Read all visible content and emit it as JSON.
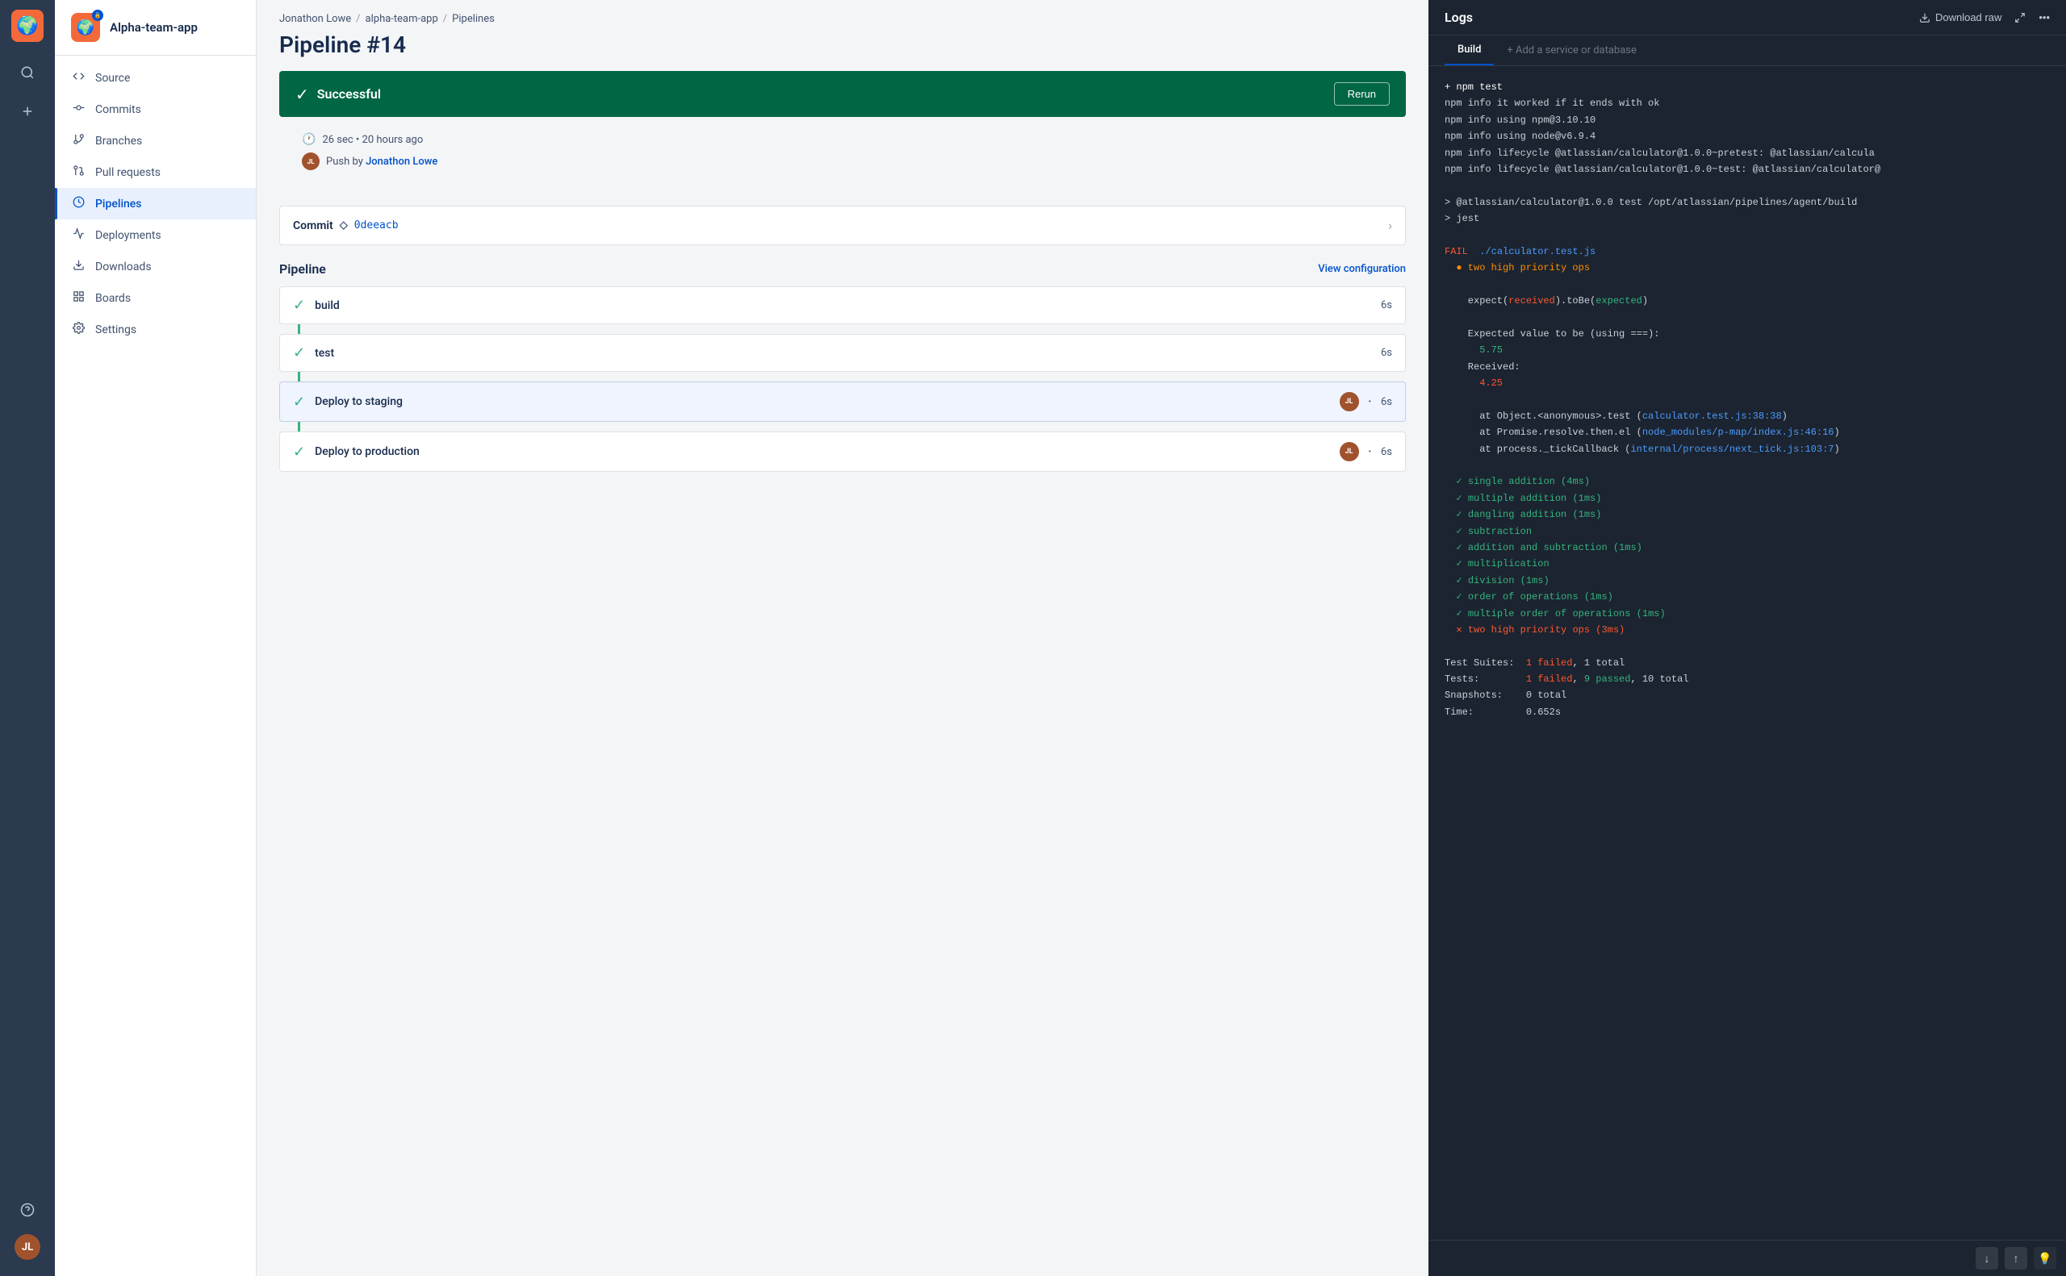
{
  "app": {
    "name": "Alpha-team-app"
  },
  "iconBar": {
    "searchLabel": "Search",
    "addLabel": "Add",
    "helpLabel": "Help",
    "profileLabel": "Profile"
  },
  "sidebar": {
    "title": "Alpha-team-app",
    "nav": [
      {
        "id": "source",
        "label": "Source",
        "icon": "<>"
      },
      {
        "id": "commits",
        "label": "Commits",
        "icon": "⌥"
      },
      {
        "id": "branches",
        "label": "Branches",
        "icon": "⎇"
      },
      {
        "id": "pull-requests",
        "label": "Pull requests",
        "icon": "⤵"
      },
      {
        "id": "pipelines",
        "label": "Pipelines",
        "icon": "○",
        "active": true
      },
      {
        "id": "deployments",
        "label": "Deployments",
        "icon": "☁"
      },
      {
        "id": "downloads",
        "label": "Downloads",
        "icon": "⬇"
      },
      {
        "id": "boards",
        "label": "Boards",
        "icon": "⬚"
      },
      {
        "id": "settings",
        "label": "Settings",
        "icon": "⚙"
      }
    ]
  },
  "breadcrumb": {
    "items": [
      "Jonathon Lowe",
      "alpha-team-app",
      "Pipelines"
    ]
  },
  "pipeline": {
    "title": "Pipeline #14",
    "status": {
      "label": "Successful",
      "rerun": "Rerun"
    },
    "meta": {
      "duration": "26 sec",
      "timeAgo": "20 hours ago",
      "pushedBy": "Push by",
      "pusher": "Jonathon Lowe"
    },
    "commit": {
      "label": "Commit",
      "hash": "0deeacb"
    },
    "sectionTitle": "Pipeline",
    "viewConfig": "View configuration",
    "steps": [
      {
        "id": "build",
        "label": "build",
        "duration": "6s",
        "hasAvatar": false
      },
      {
        "id": "test",
        "label": "test",
        "duration": "6s",
        "hasAvatar": false
      },
      {
        "id": "deploy-staging",
        "label": "Deploy to staging",
        "duration": "6s",
        "hasAvatar": true,
        "active": true
      },
      {
        "id": "deploy-production",
        "label": "Deploy to production",
        "duration": "6s",
        "hasAvatar": true
      }
    ]
  },
  "logs": {
    "title": "Logs",
    "downloadRaw": "Download raw",
    "activeTab": "Build",
    "addService": "+ Add a service or database",
    "content": [
      {
        "type": "normal",
        "text": "+ npm test"
      },
      {
        "type": "normal",
        "text": "npm info it worked if it ends with ok"
      },
      {
        "type": "normal",
        "text": "npm info using npm@3.10.10"
      },
      {
        "type": "normal",
        "text": "npm info using node@v6.9.4"
      },
      {
        "type": "normal",
        "text": "npm info lifecycle @atlassian/calculator@1.0.0~pretest: @atlassian/calcula"
      },
      {
        "type": "normal",
        "text": "npm info lifecycle @atlassian/calculator@1.0.0~test: @atlassian/calculator"
      },
      {
        "type": "empty",
        "text": ""
      },
      {
        "type": "normal",
        "text": "> @atlassian/calculator@1.0.0 test /opt/atlassian/pipelines/agent/build"
      },
      {
        "type": "normal",
        "text": "> jest"
      },
      {
        "type": "empty",
        "text": ""
      },
      {
        "type": "fail",
        "text": "FAIL  ./calculator.test.js"
      },
      {
        "type": "fail-sub",
        "text": "  ● two high priority ops"
      },
      {
        "type": "empty",
        "text": ""
      },
      {
        "type": "mixed-expect",
        "text": "    expect(received).toBe(expected)"
      },
      {
        "type": "empty",
        "text": ""
      },
      {
        "type": "normal",
        "text": "    Expected value to be (using ===):"
      },
      {
        "type": "green",
        "text": "      5.75"
      },
      {
        "type": "normal",
        "text": "    Received:"
      },
      {
        "type": "red-val",
        "text": "      4.25"
      },
      {
        "type": "empty",
        "text": ""
      },
      {
        "type": "normal",
        "text": "      at Object.<anonymous>.test (calculator.test.js:38:38)"
      },
      {
        "type": "normal",
        "text": "      at Promise.resolve.then.el (node_modules/p-map/index.js:46:16)"
      },
      {
        "type": "normal",
        "text": "      at process._tickCallback (internal/process/next_tick.js:103:7)"
      },
      {
        "type": "empty",
        "text": ""
      },
      {
        "type": "check",
        "text": "  ✓ single addition (4ms)"
      },
      {
        "type": "check",
        "text": "  ✓ multiple addition (1ms)"
      },
      {
        "type": "check",
        "text": "  ✓ dangling addition (1ms)"
      },
      {
        "type": "check",
        "text": "  ✓ subtraction"
      },
      {
        "type": "check",
        "text": "  ✓ addition and subtraction (1ms)"
      },
      {
        "type": "check",
        "text": "  ✓ multiplication"
      },
      {
        "type": "check",
        "text": "  ✓ division (1ms)"
      },
      {
        "type": "check",
        "text": "  ✓ order of operations (1ms)"
      },
      {
        "type": "check",
        "text": "  ✓ multiple order of operations (1ms)"
      },
      {
        "type": "cross",
        "text": "  ✕ two high priority ops (3ms)"
      },
      {
        "type": "empty",
        "text": ""
      },
      {
        "type": "summary-fail",
        "text": "Test Suites:  1 failed, 1 total"
      },
      {
        "type": "summary-tests",
        "text": "Tests:        1 failed, 9 passed, 10 total"
      },
      {
        "type": "normal",
        "text": "Snapshots:    0 total"
      },
      {
        "type": "normal",
        "text": "Time:         0.652s"
      }
    ]
  }
}
